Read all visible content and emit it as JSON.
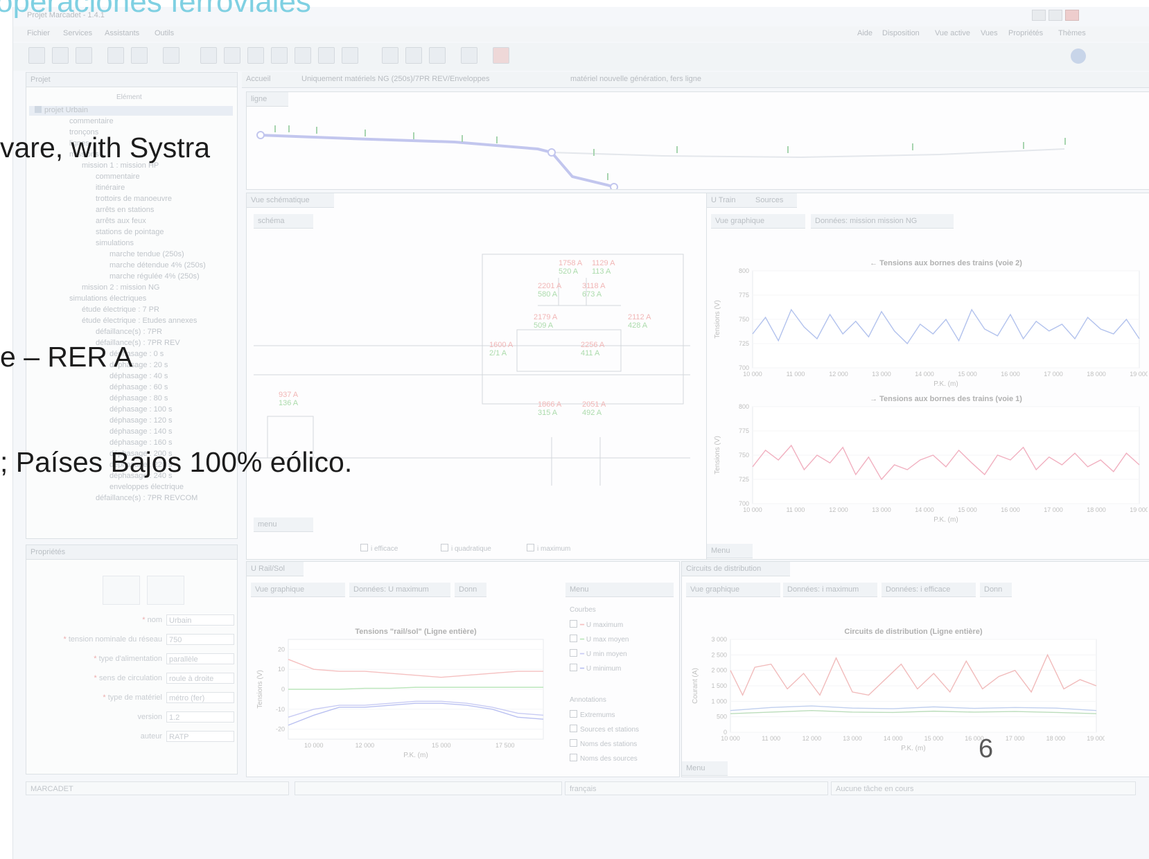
{
  "slide": {
    "title": "operaciones ferroviales",
    "bullets": [
      "vare, with Systra",
      "e – RER A",
      "; Países Bajos 100% eólico."
    ],
    "page_number": "6"
  },
  "app": {
    "window_title": "Projet Marcadet - 1.4.1",
    "menu_left": [
      "Fichier",
      "Services",
      "Assistants",
      "Outils"
    ],
    "menu_right": [
      "Aide",
      "Disposition",
      "Vue active",
      "Vues",
      "Propriétés",
      "Thèmes"
    ],
    "project_panel": {
      "title": "Projet",
      "column_header": "Elément",
      "tree": [
        "projet Urbain",
        "commentaire",
        "tronçons",
        "lignes",
        "missions",
        "mission 1 : mission HP",
        "commentaire",
        "itinéraire",
        "trottoirs de manoeuvre",
        "arrêts en stations",
        "arrêts aux feux",
        "stations de pointage",
        "simulations",
        "marche tendue (250s)",
        "marche détendue 4% (250s)",
        "marche régulée 4% (250s)",
        "mission 2 : mission NG",
        "simulations électriques",
        "étude électrique : 7 PR",
        "étude électrique : Etudes annexes",
        "défaillance(s) : 7PR",
        "défaillance(s) : 7PR REV",
        "déphasage : 0 s",
        "déphasage : 20 s",
        "déphasage : 40 s",
        "déphasage : 60 s",
        "déphasage : 80 s",
        "déphasage : 100 s",
        "déphasage : 120 s",
        "déphasage : 140 s",
        "déphasage : 160 s",
        "déphasage : 200 s",
        "déphasage : 220 s",
        "déphasage : 240 s",
        "enveloppes électrique",
        "défaillance(s) : 7PR REVCOM"
      ]
    },
    "properties_panel": {
      "title": "Propriétés",
      "fields": [
        {
          "label": "nom",
          "value": "Urbain",
          "required": true
        },
        {
          "label": "tension nominale du réseau",
          "value": "750",
          "required": true
        },
        {
          "label": "type d'alimentation",
          "value": "parallèle",
          "required": true
        },
        {
          "label": "sens de circulation",
          "value": "roule à droite",
          "required": true
        },
        {
          "label": "type de matériel",
          "value": "métro (fer)",
          "required": true
        },
        {
          "label": "version",
          "value": "1.2",
          "required": false
        },
        {
          "label": "auteur",
          "value": "RATP",
          "required": false
        }
      ]
    },
    "editor_tabs": [
      "Accueil",
      "Uniquement matériels NG (250s)/7PR REV/Enveloppes",
      "matériel nouvelle génération, fers ligne"
    ],
    "line_view_title": "ligne",
    "schema_view": {
      "title": "Vue schématique",
      "tab": "schéma",
      "currents": [
        {
          "red": "1758 A",
          "green": "520 A"
        },
        {
          "red": "1129 A",
          "green": "113 A"
        },
        {
          "red": "2201 A",
          "green": "580 A"
        },
        {
          "red": "3118 A",
          "green": "673 A"
        },
        {
          "red": "2179 A",
          "green": "509 A"
        },
        {
          "red": "2112 A",
          "green": "428 A"
        },
        {
          "red": "1600 A",
          "green": "2/1 A"
        },
        {
          "red": "2256 A",
          "green": "411 A"
        },
        {
          "red": "937 A",
          "green": "136 A"
        },
        {
          "red": "1866 A",
          "green": "315 A"
        },
        {
          "red": "2051 A",
          "green": "492 A"
        }
      ],
      "menu_title": "menu",
      "legend": [
        "i efficace",
        "i quadratique",
        "i maximum"
      ]
    },
    "utrain": {
      "tabs": [
        "U Train",
        "Sources"
      ],
      "subtabs": [
        "Vue graphique",
        "Données: mission mission NG"
      ],
      "menu_label": "Menu"
    },
    "urail": {
      "title": "U Rail/Sol",
      "subtabs": [
        "Vue graphique",
        "Données: U maximum",
        "Donn"
      ],
      "menu_title": "Menu",
      "courbes_title": "Courbes",
      "courbes": [
        "U maximum",
        "U max moyen",
        "U min moyen",
        "U minimum"
      ],
      "annotations_title": "Annotations",
      "annotations": [
        {
          "label": "Extremums",
          "checked": false
        },
        {
          "label": "Sources et stations",
          "checked": true
        },
        {
          "label": "Noms des stations",
          "checked": false
        },
        {
          "label": "Noms des sources",
          "checked": false
        }
      ]
    },
    "circuits": {
      "title": "Circuits de distribution",
      "subtabs": [
        "Vue graphique",
        "Données: i maximum",
        "Données: i efficace",
        "Donn"
      ],
      "menu_label": "Menu"
    },
    "status_bar": [
      "MARCADET",
      "",
      "français",
      "Aucune tâche en cours"
    ]
  },
  "chart_data": [
    {
      "type": "line",
      "title": "← Tensions aux bornes des trains (voie 2)",
      "xlabel": "P.K. (m)",
      "ylabel": "Tensions (V)",
      "x_ticks": [
        "10 000",
        "11 000",
        "12 000",
        "13 000",
        "14 000",
        "15 000",
        "16 000",
        "17 000",
        "18 000",
        "19 000"
      ],
      "y_ticks": [
        "700",
        "725",
        "750",
        "775",
        "800"
      ],
      "xlim": [
        10000,
        19000
      ],
      "ylim": [
        700,
        800
      ],
      "color": "#4a6fd6",
      "x": [
        10000,
        10300,
        10600,
        10900,
        11200,
        11500,
        11800,
        12100,
        12400,
        12700,
        13000,
        13300,
        13600,
        13900,
        14200,
        14500,
        14800,
        15100,
        15400,
        15700,
        16000,
        16300,
        16600,
        16900,
        17200,
        17500,
        17800,
        18100,
        18400,
        18700,
        19000
      ],
      "y": [
        735,
        752,
        728,
        760,
        742,
        730,
        755,
        735,
        748,
        732,
        758,
        738,
        725,
        745,
        735,
        750,
        728,
        760,
        740,
        733,
        755,
        730,
        748,
        738,
        745,
        730,
        752,
        740,
        735,
        750,
        730
      ]
    },
    {
      "type": "line",
      "title": "→ Tensions aux bornes des trains (voie 1)",
      "xlabel": "P.K. (m)",
      "ylabel": "Tensions (V)",
      "x_ticks": [
        "10 000",
        "11 000",
        "12 000",
        "13 000",
        "14 000",
        "15 000",
        "16 000",
        "17 000",
        "18 000",
        "19 000"
      ],
      "y_ticks": [
        "700",
        "725",
        "750",
        "775",
        "800"
      ],
      "xlim": [
        10000,
        19000
      ],
      "ylim": [
        700,
        800
      ],
      "color": "#e0456a",
      "x": [
        10000,
        10300,
        10600,
        10900,
        11200,
        11500,
        11800,
        12100,
        12400,
        12700,
        13000,
        13300,
        13600,
        13900,
        14200,
        14500,
        14800,
        15100,
        15400,
        15700,
        16000,
        16300,
        16600,
        16900,
        17200,
        17500,
        17800,
        18100,
        18400,
        18700,
        19000
      ],
      "y": [
        738,
        755,
        745,
        760,
        735,
        750,
        742,
        758,
        730,
        748,
        725,
        740,
        735,
        745,
        750,
        738,
        755,
        742,
        730,
        750,
        745,
        758,
        735,
        748,
        740,
        752,
        738,
        745,
        733,
        752,
        740
      ]
    },
    {
      "type": "line",
      "title": "Tensions \"rail/sol\" (Ligne entière)",
      "xlabel": "P.K. (m)",
      "ylabel": "Tensions (V)",
      "x_ticks": [
        "10 000",
        "12 000",
        "15 000",
        "17 500"
      ],
      "y_ticks": [
        "-20",
        "-10",
        "0",
        "10",
        "20"
      ],
      "xlim": [
        9000,
        19000
      ],
      "ylim": [
        -25,
        25
      ],
      "series": [
        {
          "name": "U maximum",
          "color": "#e86a6a",
          "x": [
            9000,
            10000,
            11000,
            12000,
            13000,
            14000,
            15000,
            16000,
            17000,
            18000,
            19000
          ],
          "y": [
            15,
            10,
            9,
            9,
            8,
            7,
            6,
            7,
            8,
            9,
            9
          ]
        },
        {
          "name": "U max moyen",
          "color": "#5fc45f",
          "x": [
            9000,
            10000,
            11000,
            12000,
            13000,
            14000,
            15000,
            16000,
            17000,
            18000,
            19000
          ],
          "y": [
            0,
            0,
            0,
            0.5,
            0.5,
            1,
            1,
            1,
            1,
            1,
            1
          ]
        },
        {
          "name": "U min moyen",
          "color": "#7d86e6",
          "x": [
            9000,
            10000,
            11000,
            12000,
            13000,
            14000,
            15000,
            16000,
            17000,
            18000,
            19000
          ],
          "y": [
            -14,
            -10,
            -8,
            -8,
            -7,
            -6,
            -6,
            -7,
            -9,
            -12,
            -13
          ]
        },
        {
          "name": "U minimum",
          "color": "#5a6be0",
          "x": [
            9000,
            10000,
            11000,
            12000,
            13000,
            14000,
            15000,
            16000,
            17000,
            18000,
            19000
          ],
          "y": [
            -18,
            -13,
            -9,
            -9,
            -8,
            -7,
            -7,
            -8,
            -10,
            -14,
            -15
          ]
        }
      ]
    },
    {
      "type": "line",
      "title": "Circuits de distribution (Ligne entière)",
      "xlabel": "P.K. (m)",
      "ylabel": "Courant (A)",
      "x_ticks": [
        "10 000",
        "11 000",
        "12 000",
        "13 000",
        "14 000",
        "15 000",
        "16 000",
        "17 000",
        "18 000",
        "19 000"
      ],
      "y_ticks": [
        "0",
        "500",
        "1 000",
        "1 500",
        "2 000",
        "2 500",
        "3 000"
      ],
      "xlim": [
        10000,
        19000
      ],
      "ylim": [
        0,
        3000
      ],
      "series": [
        {
          "name": "i maximum",
          "color": "#e06060",
          "x": [
            10000,
            10300,
            10600,
            11000,
            11400,
            11800,
            12200,
            12600,
            13000,
            13400,
            13800,
            14200,
            14600,
            15000,
            15400,
            15800,
            16200,
            16600,
            17000,
            17400,
            17800,
            18200,
            18600,
            19000
          ],
          "y": [
            2000,
            1200,
            2100,
            2200,
            1400,
            1900,
            1200,
            2400,
            1300,
            1200,
            1700,
            2200,
            1400,
            1900,
            1300,
            2300,
            1400,
            1800,
            2000,
            1300,
            2500,
            1400,
            1700,
            1500
          ]
        },
        {
          "name": "i efficace",
          "color": "#6a8fd8",
          "x": [
            10000,
            11000,
            12000,
            13000,
            14000,
            15000,
            16000,
            17000,
            18000,
            19000
          ],
          "y": [
            700,
            800,
            850,
            780,
            760,
            820,
            770,
            800,
            780,
            700
          ]
        },
        {
          "name": "i quadratique",
          "color": "#60b060",
          "x": [
            10000,
            11000,
            12000,
            13000,
            14000,
            15000,
            16000,
            17000,
            18000,
            19000
          ],
          "y": [
            600,
            650,
            700,
            650,
            640,
            680,
            650,
            670,
            640,
            600
          ]
        }
      ]
    }
  ]
}
